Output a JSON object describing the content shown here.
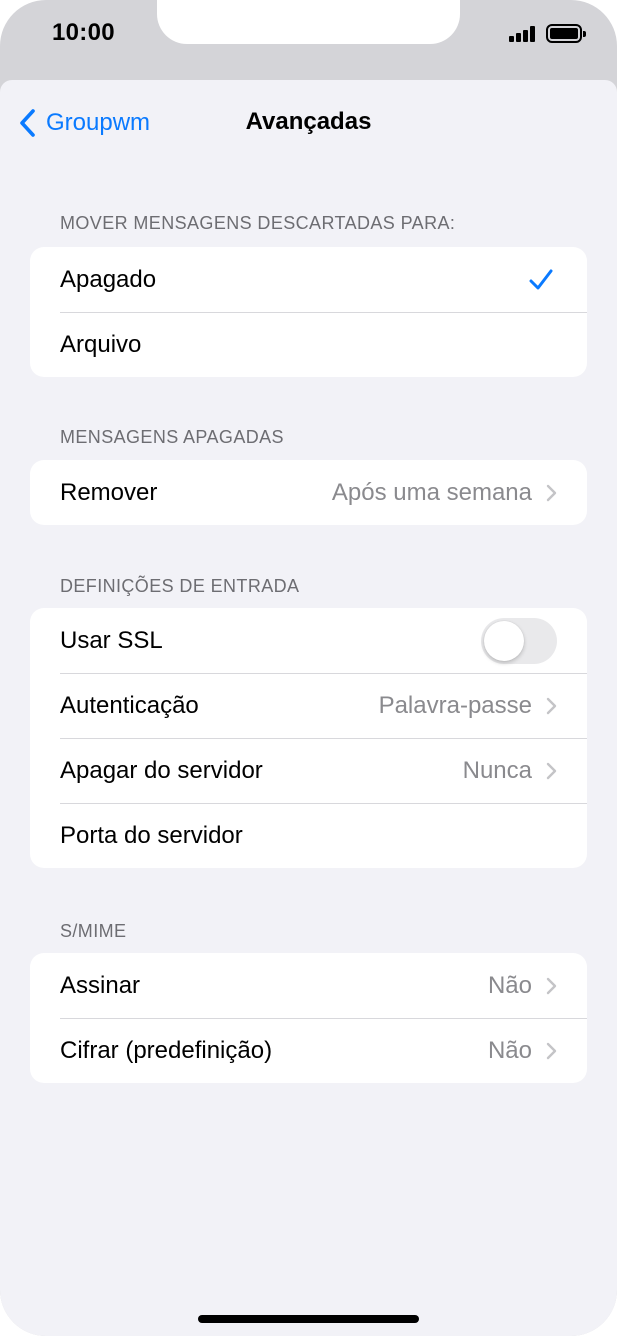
{
  "status_bar": {
    "time": "10:00"
  },
  "nav": {
    "back_label": "Groupwm",
    "title": "Avançadas"
  },
  "sections": [
    {
      "header": "MOVER MENSAGENS DESCARTADAS PARA:",
      "rows": [
        {
          "label": "Apagado",
          "checked": true
        },
        {
          "label": "Arquivo",
          "checked": false
        }
      ]
    },
    {
      "header": "MENSAGENS APAGADAS",
      "rows": [
        {
          "label": "Remover",
          "value": "Após uma semana"
        }
      ]
    },
    {
      "header": "DEFINIÇÕES DE ENTRADA",
      "rows": [
        {
          "label": "Usar SSL",
          "toggle": false
        },
        {
          "label": "Autenticação",
          "value": "Palavra-passe"
        },
        {
          "label": "Apagar do servidor",
          "value": "Nunca"
        },
        {
          "label": "Porta do servidor"
        }
      ]
    },
    {
      "header": "S/MIME",
      "rows": [
        {
          "label": "Assinar",
          "value": "Não"
        },
        {
          "label": "Cifrar (predefinição)",
          "value": "Não"
        }
      ]
    }
  ],
  "colors": {
    "accent": "#0a7aff",
    "background": "#f2f2f7",
    "secondary_text": "#8a8a8e"
  }
}
